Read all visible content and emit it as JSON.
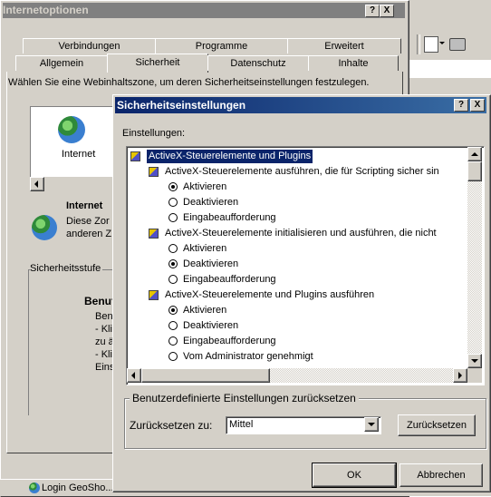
{
  "outer": {
    "title": "Internetoptionen",
    "help": "?",
    "close": "X",
    "tabs_row1": [
      "Verbindungen",
      "Programme",
      "Erweitert"
    ],
    "tabs_row2": [
      "Allgemein",
      "Sicherheit",
      "Datenschutz",
      "Inhalte"
    ],
    "instruction": "Wählen Sie eine Webinhaltszone, um deren Sicherheitseinstellungen festzulegen.",
    "zone_label": "Internet",
    "zone_title": "Internet",
    "zone_desc_1": "Diese Zor",
    "zone_desc_2": "anderen Z",
    "security_level_label": "Sicherheitsstufe",
    "level_title": "Benut",
    "level_lines": [
      "Ben",
      "- Kli",
      "zu ä",
      "- Kli",
      "Eins"
    ]
  },
  "dialog": {
    "title": "Sicherheitseinstellungen",
    "help": "?",
    "close": "X",
    "settings_label": "Einstellungen:",
    "items": [
      {
        "kind": "category",
        "text": "ActiveX-Steuerelemente und Plugins",
        "selected": true
      },
      {
        "kind": "setting",
        "text": "ActiveX-Steuerelemente ausführen, die für Scripting sicher sin"
      },
      {
        "kind": "option",
        "text": "Aktivieren",
        "checked": true
      },
      {
        "kind": "option",
        "text": "Deaktivieren",
        "checked": false
      },
      {
        "kind": "option",
        "text": "Eingabeaufforderung",
        "checked": false
      },
      {
        "kind": "setting",
        "text": "ActiveX-Steuerelemente initialisieren und ausführen, die nicht"
      },
      {
        "kind": "option",
        "text": "Aktivieren",
        "checked": false
      },
      {
        "kind": "option",
        "text": "Deaktivieren",
        "checked": true
      },
      {
        "kind": "option",
        "text": "Eingabeaufforderung",
        "checked": false
      },
      {
        "kind": "setting",
        "text": "ActiveX-Steuerelemente und Plugins ausführen"
      },
      {
        "kind": "option",
        "text": "Aktivieren",
        "checked": true
      },
      {
        "kind": "option",
        "text": "Deaktivieren",
        "checked": false
      },
      {
        "kind": "option",
        "text": "Eingabeaufforderung",
        "checked": false
      },
      {
        "kind": "option",
        "text": "Vom Administrator genehmigt",
        "checked": false
      }
    ],
    "reset_group_label": "Benutzerdefinierte Einstellungen zurücksetzen",
    "reset_to_label": "Zurücksetzen zu:",
    "reset_value": "Mittel",
    "reset_button": "Zurücksetzen",
    "ok_button": "OK",
    "cancel_button": "Abbrechen"
  },
  "taskbar": {
    "item": "Login GeoSho..."
  }
}
